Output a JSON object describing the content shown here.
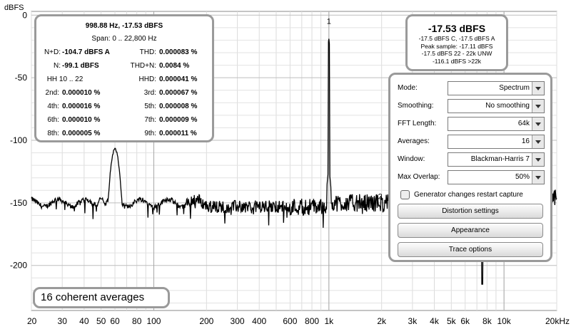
{
  "plot": {
    "y_unit": "dBFS",
    "y_ticks": [
      {
        "label": "0",
        "v": 0
      },
      {
        "label": "-50",
        "v": -50
      },
      {
        "label": "-100",
        "v": -100
      },
      {
        "label": "-150",
        "v": -150
      },
      {
        "label": "-200",
        "v": -200
      }
    ],
    "x_ticks": [
      {
        "label": "20",
        "f": 20
      },
      {
        "label": "30",
        "f": 30
      },
      {
        "label": "40",
        "f": 40
      },
      {
        "label": "50",
        "f": 50
      },
      {
        "label": "60",
        "f": 60
      },
      {
        "label": "80",
        "f": 80
      },
      {
        "label": "100",
        "f": 100
      },
      {
        "label": "200",
        "f": 200
      },
      {
        "label": "300",
        "f": 300
      },
      {
        "label": "400",
        "f": 400
      },
      {
        "label": "600",
        "f": 600
      },
      {
        "label": "800",
        "f": 800
      },
      {
        "label": "1k",
        "f": 1000
      },
      {
        "label": "2k",
        "f": 2000
      },
      {
        "label": "3k",
        "f": 3000
      },
      {
        "label": "4k",
        "f": 4000
      },
      {
        "label": "5k",
        "f": 5000
      },
      {
        "label": "6k",
        "f": 6000
      },
      {
        "label": "8k",
        "f": 8000
      },
      {
        "label": "10k",
        "f": 10000
      },
      {
        "label": "20kHz",
        "f": 20000
      }
    ],
    "harmonic_markers": [
      {
        "label": "1",
        "f": 1000,
        "v": -7
      },
      {
        "label": "2",
        "f": 2000,
        "v": -147
      }
    ],
    "trace_color": "#000000"
  },
  "stats": {
    "header": "998.88 Hz, -17.53 dBFS",
    "span": "Span: 0 .. 22,800 Hz",
    "nd_label": "N+D:",
    "nd_value": "-104.7 dBFS A",
    "thd_label": "THD:",
    "thd_value": "0.000083 %",
    "n_label": "N:",
    "n_value": "-99.1 dBFS",
    "thdn_label": "THD+N:",
    "thdn_value": "0.0084 %",
    "hh_label": "HH 10 .. 22",
    "hhd_label": "HHD:",
    "hhd_value": "0.000041 %",
    "h2_label": "2nd:",
    "h2_value": "0.000010 %",
    "h3_label": "3rd:",
    "h3_value": "0.000067 %",
    "h4_label": "4th:",
    "h4_value": "0.000016 %",
    "h5_label": "5th:",
    "h5_value": "0.000008 %",
    "h6_label": "6th:",
    "h6_value": "0.000010 %",
    "h7_label": "7th:",
    "h7_value": "0.000009 %",
    "h8_label": "8th:",
    "h8_value": "0.000005 %",
    "h9_label": "9th:",
    "h9_value": "0.000011 %"
  },
  "peak": {
    "level": "-17.53 dBFS",
    "line1": "-17.5 dBFS C, -17.5 dBFS A",
    "line2": "Peak sample: -17.11 dBFS",
    "line3": "-17.5 dBFS 22 - 22k UNW",
    "line4": "-116.1 dBFS >22k"
  },
  "controls": {
    "mode_label": "Mode:",
    "mode_value": "Spectrum",
    "smoothing_label": "Smoothing:",
    "smoothing_value": "No  smoothing",
    "fft_label": "FFT Length:",
    "fft_value": "64k",
    "averages_label": "Averages:",
    "averages_value": "16",
    "window_label": "Window:",
    "window_value": "Blackman-Harris 7",
    "overlap_label": "Max Overlap:",
    "overlap_value": "50%",
    "generator_checkbox_label": "Generator changes restart capture",
    "generator_checked": false,
    "distortion_button": "Distortion settings",
    "appearance_button": "Appearance",
    "trace_button": "Trace options"
  },
  "averages_status": "16 coherent averages"
}
